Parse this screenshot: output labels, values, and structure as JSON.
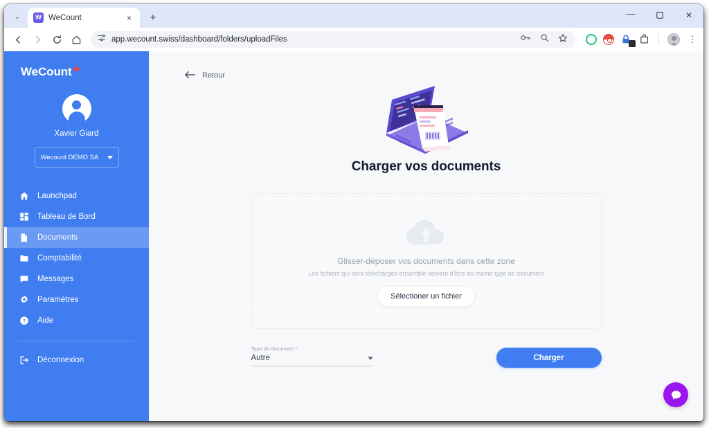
{
  "browser": {
    "tab": {
      "title": "WeCount",
      "favicon_letter": "W",
      "favicon_name": "wecount-favicon",
      "close_glyph": "×"
    },
    "new_tab_glyph": "+",
    "tab_list_glyph": "⌄",
    "window_controls": {
      "minimize": "—",
      "maximize": "❐",
      "close": "✕"
    },
    "nav": {
      "back": "←",
      "forward": "→",
      "reload": "↻",
      "home": "⌂"
    },
    "omnibox": {
      "url": "app.wecount.swiss/dashboard/folders/uploadFiles",
      "site_settings_icon": "tune-icon",
      "actions": [
        "passkey-icon",
        "search-icon",
        "bookmark-star-icon"
      ]
    },
    "extensions": [
      "green-ring-extension-icon",
      "pokeball-extension-icon",
      "lastpass-lock-icon",
      "extensions-puzzle-icon"
    ],
    "profile_icon": "chrome-profile-avatar",
    "menu_glyph": "⋮"
  },
  "sidebar": {
    "brand": "WeCount",
    "brand_mark": "swiss-cross",
    "user_name": "Xavier Giard",
    "company": {
      "label": "Wecount DEMO SA"
    },
    "items": [
      {
        "label": "Launchpad",
        "icon": "home-icon",
        "active": false
      },
      {
        "label": "Tableau de Bord",
        "icon": "dashboard-icon",
        "active": false
      },
      {
        "label": "Documents",
        "icon": "document-icon",
        "active": true
      },
      {
        "label": "Comptabilité",
        "icon": "folder-icon",
        "active": false
      },
      {
        "label": "Messages",
        "icon": "chat-icon",
        "active": false
      },
      {
        "label": "Paramètres",
        "icon": "gear-icon",
        "active": false
      },
      {
        "label": "Aide",
        "icon": "help-icon",
        "active": false
      }
    ],
    "logout": {
      "label": "Déconnexion",
      "icon": "logout-icon"
    },
    "colors": {
      "background": "#3f7df0",
      "active": "#6b9af4",
      "accent": "#eef3fe"
    }
  },
  "main": {
    "back": {
      "label": "Retour",
      "icon": "arrow-left-icon"
    },
    "hero_illustration": "laptop-receipt-illustration",
    "title": "Charger vos documents",
    "dropzone": {
      "icon": "cloud-upload-icon",
      "primary_text": "Glisser-déposer vos documents dans cette zone",
      "secondary_text": "Les fichiers qui sont téléchargés ensemble doivent d'être du même type de document",
      "button_label": "Sélectioner un fichier"
    },
    "doc_type": {
      "label": "Type de document *",
      "value": "Autre"
    },
    "submit_label": "Charger",
    "chat_widget": {
      "icon": "chat-bubble-icon",
      "color": "#9b15ef"
    }
  }
}
